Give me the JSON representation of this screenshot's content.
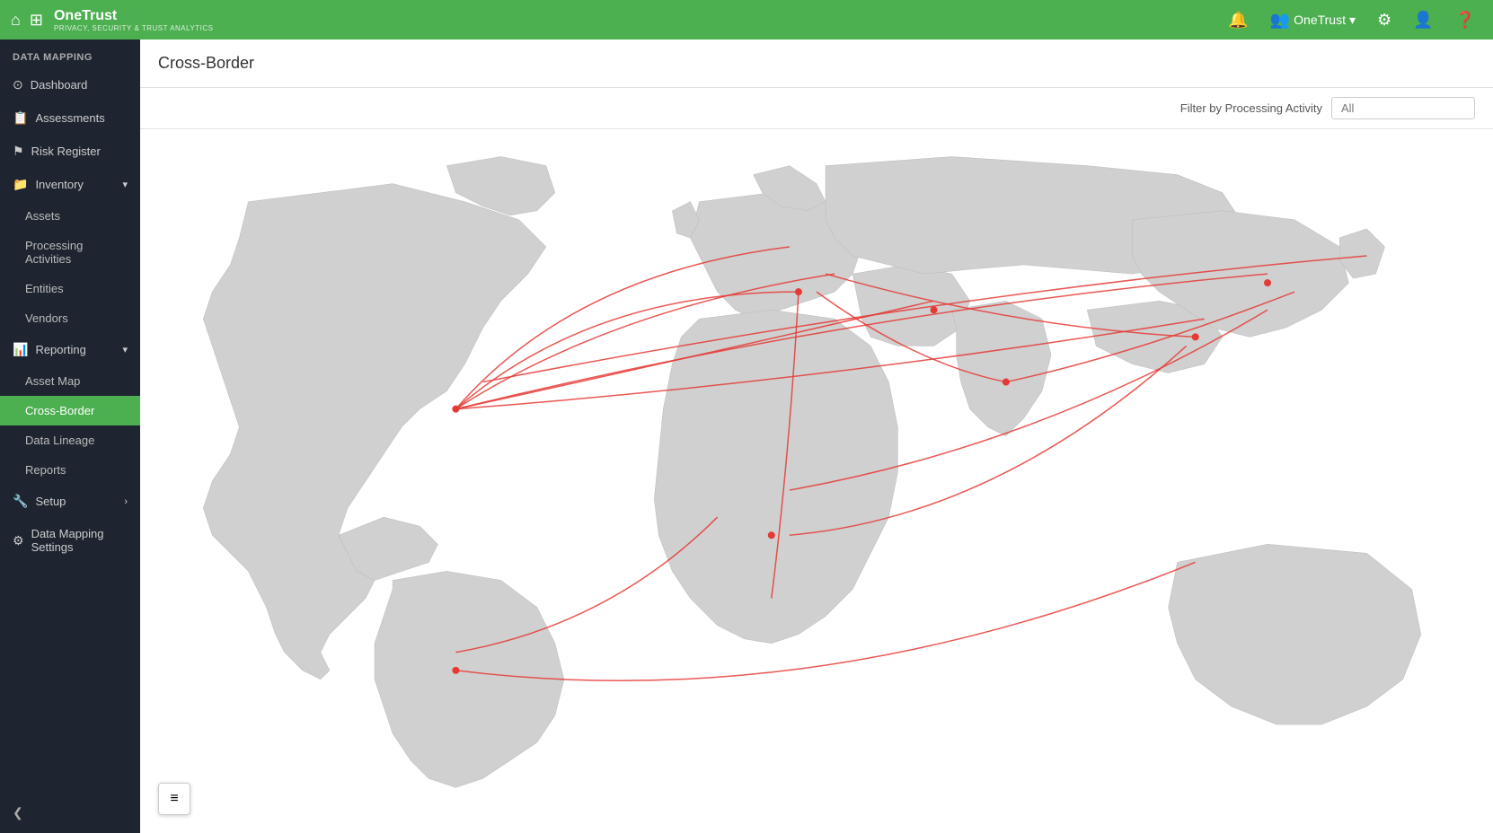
{
  "topNav": {
    "homeIcon": "⌂",
    "gridIcon": "⊞",
    "brandName": "OneTrust",
    "brandSub": "PRIVACY, SECURITY & TRUST ANALYTICS",
    "bellIcon": "🔔",
    "userLabel": "OneTrust",
    "userDropdownIcon": "▾",
    "settingsIcon": "⚙",
    "profileIcon": "👤",
    "helpIcon": "❓"
  },
  "sidebar": {
    "sectionLabel": "DATA MAPPING",
    "items": [
      {
        "id": "dashboard",
        "label": "Dashboard",
        "icon": "⊙",
        "active": false
      },
      {
        "id": "assessments",
        "label": "Assessments",
        "icon": "📋",
        "active": false
      },
      {
        "id": "risk-register",
        "label": "Risk Register",
        "icon": "⚑",
        "active": false
      },
      {
        "id": "inventory",
        "label": "Inventory",
        "icon": "📁",
        "active": false,
        "hasArrow": true,
        "expanded": true
      },
      {
        "id": "assets",
        "label": "Assets",
        "icon": "",
        "sub": true,
        "active": false
      },
      {
        "id": "processing-activities",
        "label": "Processing Activities",
        "icon": "",
        "sub": true,
        "active": false
      },
      {
        "id": "entities",
        "label": "Entities",
        "icon": "",
        "sub": true,
        "active": false
      },
      {
        "id": "vendors",
        "label": "Vendors",
        "icon": "",
        "sub": true,
        "active": false
      },
      {
        "id": "reporting",
        "label": "Reporting",
        "icon": "📊",
        "active": false,
        "hasArrow": true,
        "expanded": true
      },
      {
        "id": "asset-map",
        "label": "Asset Map",
        "icon": "",
        "sub": true,
        "active": false
      },
      {
        "id": "cross-border",
        "label": "Cross-Border",
        "icon": "",
        "sub": true,
        "active": true
      },
      {
        "id": "data-lineage",
        "label": "Data Lineage",
        "icon": "",
        "sub": true,
        "active": false
      },
      {
        "id": "reports",
        "label": "Reports",
        "icon": "",
        "sub": true,
        "active": false
      },
      {
        "id": "setup",
        "label": "Setup",
        "icon": "🔧",
        "active": false,
        "hasArrow": true
      },
      {
        "id": "data-mapping-settings",
        "label": "Data Mapping Settings",
        "icon": "⚙",
        "active": false
      }
    ],
    "collapseIcon": "❮",
    "layersIcon": "≡"
  },
  "page": {
    "title": "Cross-Border",
    "filterLabel": "Filter by Processing Activity",
    "filterPlaceholder": "All"
  }
}
